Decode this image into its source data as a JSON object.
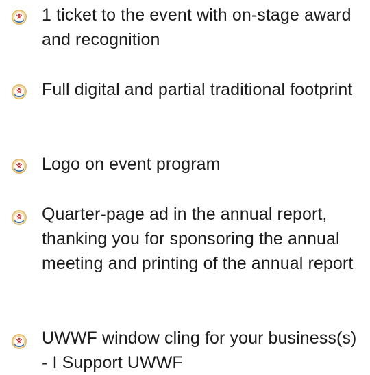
{
  "benefits": [
    {
      "icon": "sponsor-emblem-icon",
      "text": "1 ticket to the event with on-stage award and recognition"
    },
    {
      "icon": "sponsor-emblem-icon",
      "text": "Full digital and partial traditional footprint"
    },
    {
      "icon": "sponsor-emblem-icon",
      "text": "Logo on event program"
    },
    {
      "icon": "sponsor-emblem-icon",
      "text": "Quarter-page ad in the annual report, thanking you for sponsoring the annual meeting and printing of the annual report"
    },
    {
      "icon": "sponsor-emblem-icon",
      "text": "UWWF window cling for your business(s) - I Support UWWF"
    }
  ],
  "colors": {
    "text": "#1c1c1c",
    "icon_gold": "#e0b45a",
    "icon_blue": "#2f6fb5",
    "icon_red": "#cc2b2b"
  }
}
